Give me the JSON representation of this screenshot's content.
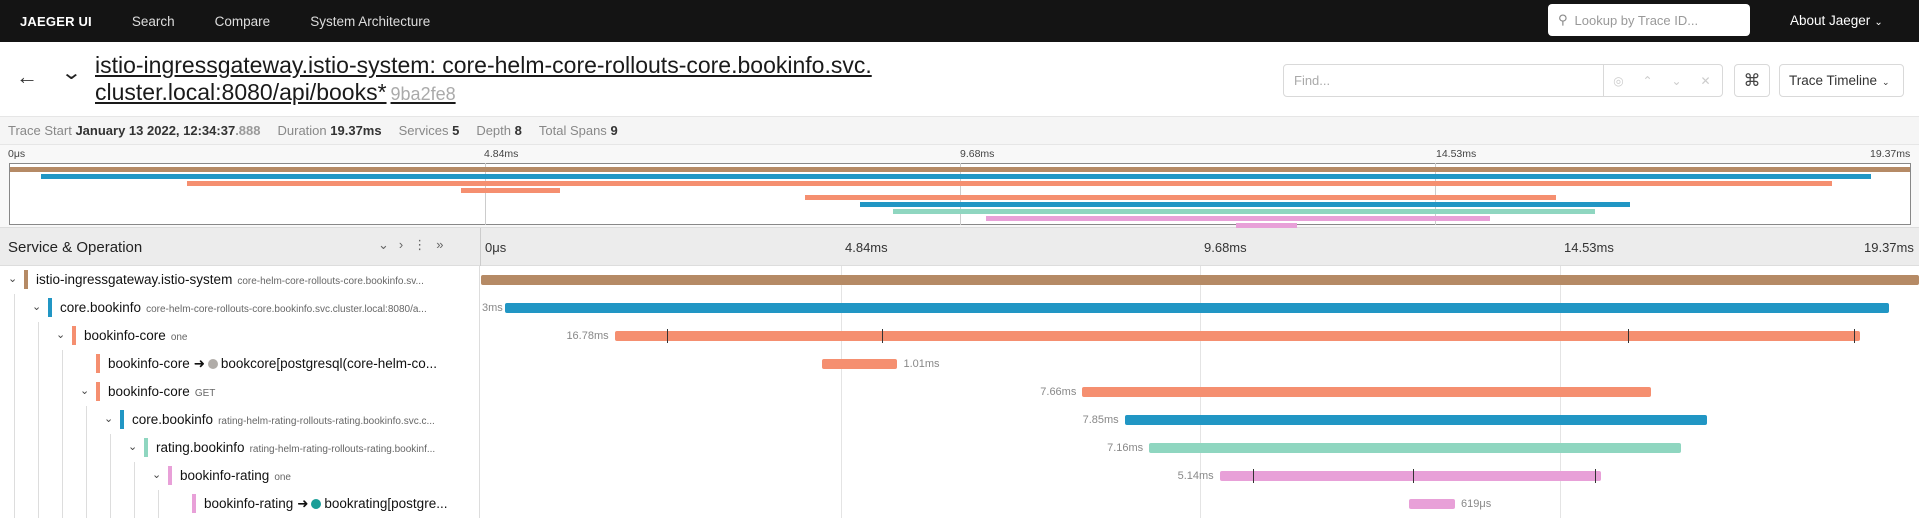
{
  "nav": {
    "brand": "JAEGER UI",
    "links": [
      "Search",
      "Compare",
      "System Architecture"
    ],
    "lookup_placeholder": "Lookup by Trace ID...",
    "about": "About Jaeger"
  },
  "trace": {
    "title_line1": "istio-ingressgateway.istio-system: core-helm-core-rollouts-core.bookinfo.svc.",
    "title_line2": "cluster.local:8080/api/books*",
    "trace_id": "9ba2fe8",
    "find_placeholder": "Find...",
    "view_select": "Trace Timeline"
  },
  "summary": {
    "trace_start_label": "Trace Start",
    "trace_start_value": "January 13 2022, 12:34:37",
    "trace_start_ms": ".888",
    "duration_label": "Duration",
    "duration_value": "19.37ms",
    "services_label": "Services",
    "services_value": "5",
    "depth_label": "Depth",
    "depth_value": "8",
    "spans_label": "Total Spans",
    "spans_value": "9"
  },
  "ticks": [
    "0μs",
    "4.84ms",
    "9.68ms",
    "14.53ms",
    "19.37ms"
  ],
  "timeline_header": {
    "title": "Service & Operation"
  },
  "colors": {
    "istio": "#b58a65",
    "core": "#2196c4",
    "bookinfo_core": "#f58f70",
    "rating": "#8fd6c0",
    "bookinfo_rating": "#e8a0d8"
  },
  "spans": [
    {
      "service": "istio-ingressgateway.istio-system",
      "operation": "core-helm-core-rollouts-core.bookinfo.sv...",
      "color": "#b58a65",
      "depth": 0,
      "start_ms": 0.0,
      "end_ms": 19.37,
      "label": "",
      "ticks": []
    },
    {
      "service": "core.bookinfo",
      "operation": "core-helm-core-rollouts-core.bookinfo.svc.cluster.local:8080/a...",
      "color": "#2196c4",
      "depth": 1,
      "start_ms": 0.32,
      "end_ms": 18.97,
      "label": "3ms",
      "ticks": []
    },
    {
      "service": "bookinfo-core",
      "operation": "one",
      "color": "#f58f70",
      "depth": 2,
      "start_ms": 1.8,
      "end_ms": 18.58,
      "label": "16.78ms",
      "ticks": [
        2.5,
        5.4,
        15.45,
        18.5
      ]
    },
    {
      "service": "bookinfo-core",
      "operation": "",
      "target": "bookcore[postgresql(core-helm-co...",
      "dot": "#b0aca8",
      "color": "#f58f70",
      "depth": 3,
      "start_ms": 4.6,
      "end_ms": 5.61,
      "label": "1.01ms",
      "ticks": []
    },
    {
      "service": "bookinfo-core",
      "operation": "GET",
      "color": "#f58f70",
      "depth": 3,
      "start_ms": 8.1,
      "end_ms": 15.76,
      "label": "7.66ms",
      "ticks": []
    },
    {
      "service": "core.bookinfo",
      "operation": "rating-helm-rating-rollouts-rating.bookinfo.svc.c...",
      "color": "#2196c4",
      "depth": 4,
      "start_ms": 8.67,
      "end_ms": 16.52,
      "label": "7.85ms",
      "ticks": []
    },
    {
      "service": "rating.bookinfo",
      "operation": "rating-helm-rating-rollouts-rating.bookinf...",
      "color": "#8fd6c0",
      "depth": 5,
      "start_ms": 9.0,
      "end_ms": 16.16,
      "label": "7.16ms",
      "ticks": []
    },
    {
      "service": "bookinfo-rating",
      "operation": "one",
      "color": "#e8a0d8",
      "depth": 6,
      "start_ms": 9.95,
      "end_ms": 15.09,
      "label": "5.14ms",
      "ticks": [
        10.4,
        12.55,
        15.0
      ]
    },
    {
      "service": "bookinfo-rating",
      "operation": "",
      "target": "bookrating[postgre...",
      "dot": "#1a9e98",
      "color": "#e8a0d8",
      "depth": 7,
      "start_ms": 12.5,
      "end_ms": 13.12,
      "label": "619μs",
      "ticks": []
    }
  ]
}
